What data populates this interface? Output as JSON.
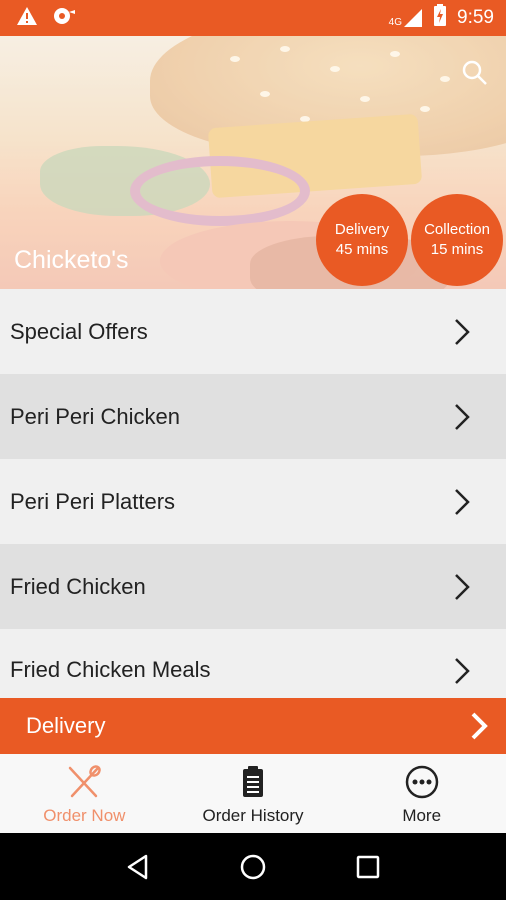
{
  "status_bar": {
    "time": "9:59",
    "network": "4G",
    "icons": [
      "warning-icon",
      "notification-icon",
      "signal-icon",
      "battery-icon"
    ]
  },
  "header": {
    "store_name": "Chicketo's",
    "delivery_badge": {
      "label": "Delivery",
      "time": "45 mins"
    },
    "collection_badge": {
      "label": "Collection",
      "time": "15 mins"
    },
    "search_icon": "search-icon"
  },
  "menu": {
    "items": [
      {
        "label": "Special Offers"
      },
      {
        "label": "Peri Peri Chicken"
      },
      {
        "label": "Peri Peri Platters"
      },
      {
        "label": "Fried Chicken"
      },
      {
        "label": "Fried Chicken Meals"
      }
    ]
  },
  "order_bar": {
    "label": "Delivery"
  },
  "tabs": [
    {
      "label": "Order Now",
      "icon": "fork-knife-icon",
      "active": true
    },
    {
      "label": "Order History",
      "icon": "clipboard-icon",
      "active": false
    },
    {
      "label": "More",
      "icon": "more-icon",
      "active": false
    }
  ],
  "colors": {
    "accent": "#e95a24",
    "active_tab": "#f0906b"
  }
}
